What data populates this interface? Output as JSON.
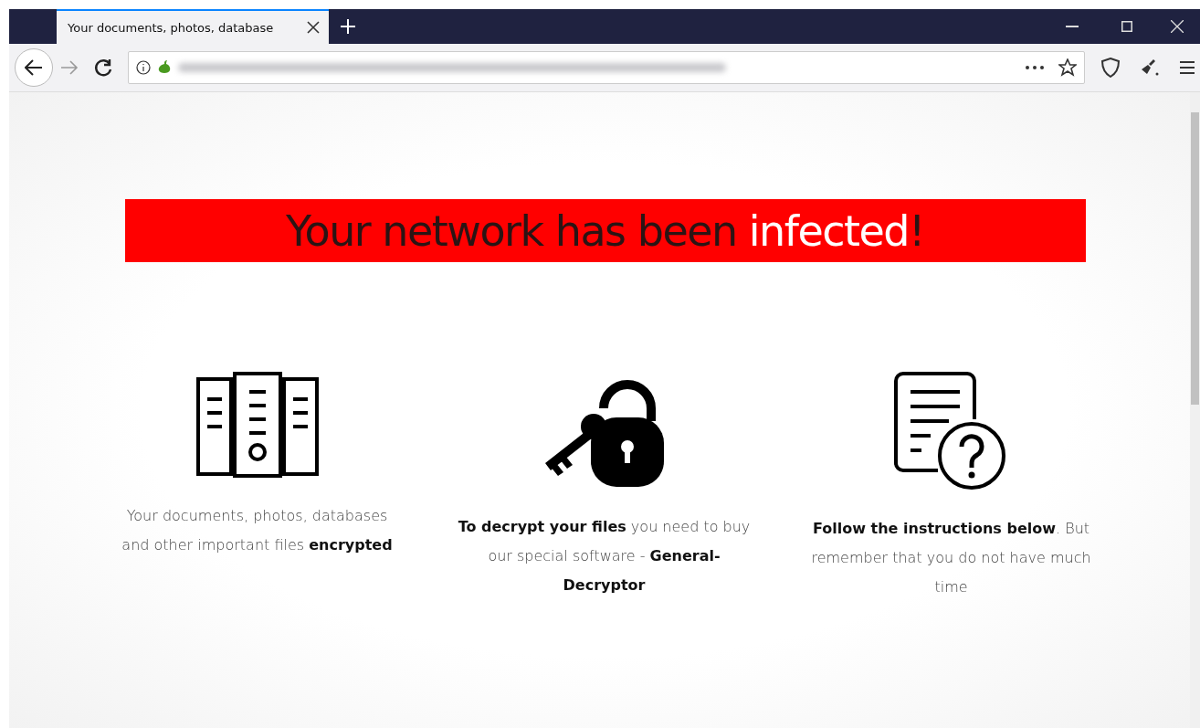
{
  "tabs": [
    {
      "title": "Your documents, photos, database",
      "selected": true
    }
  ],
  "headline": [
    {
      "text": "Your network has been ",
      "kind": "dark"
    },
    {
      "text": "infected",
      "kind": "light"
    },
    {
      "text": "!",
      "kind": "dark"
    }
  ],
  "features": [
    {
      "kind": "servers",
      "text": "Your documents, photos, databases and other important files **encrypted**"
    },
    {
      "kind": "lock",
      "text": "**To decrypt your files** you need to buy our special software - **General-Decryptor**"
    },
    {
      "kind": "help",
      "text": "**Follow the instructions below**. But remember that you do not have much time"
    }
  ]
}
